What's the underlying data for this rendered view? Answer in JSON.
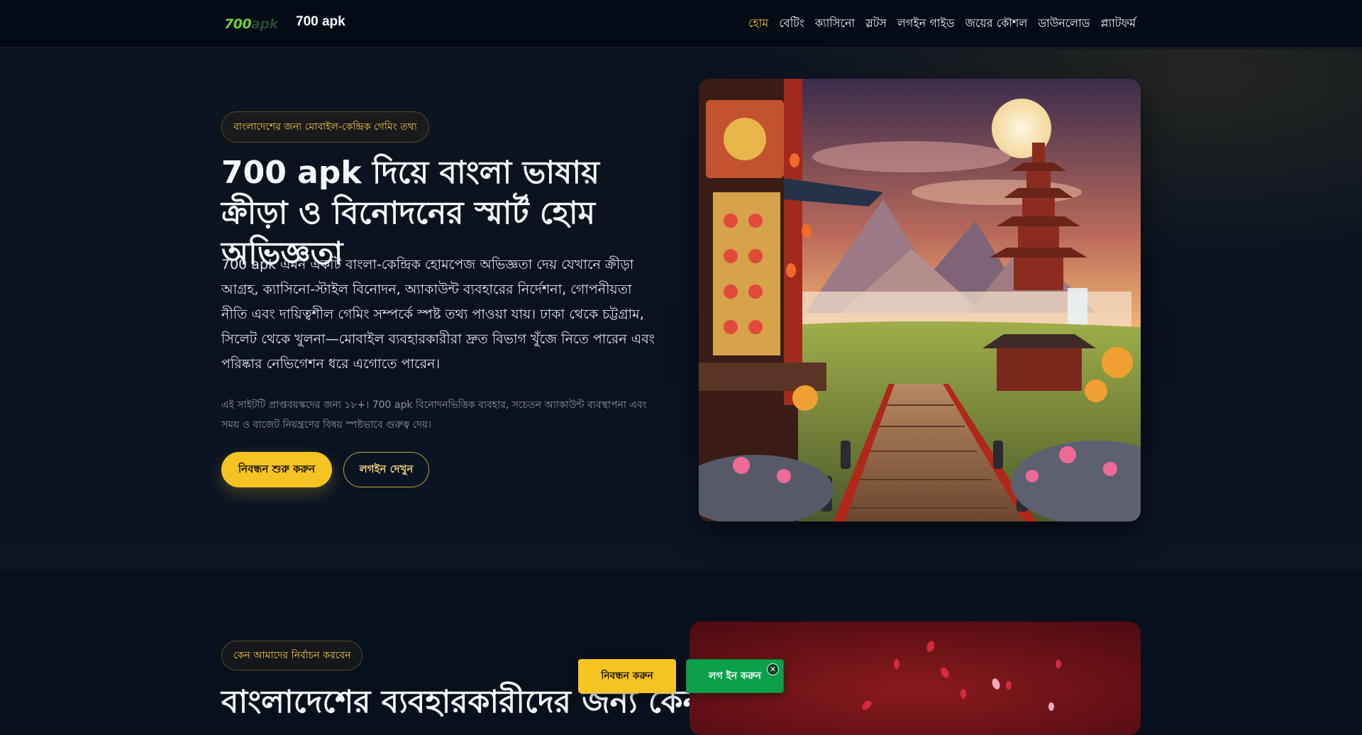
{
  "header": {
    "logo_primary": "700",
    "logo_secondary": "apk",
    "site_name": "700 apk",
    "nav": [
      {
        "label": "হোম",
        "active": true
      },
      {
        "label": "বেটিং"
      },
      {
        "label": "ক্যাসিনো"
      },
      {
        "label": "স্লটস"
      },
      {
        "label": "লগইন গাইড"
      },
      {
        "label": "জয়ের কৌশল"
      },
      {
        "label": "ডাউনলোড"
      },
      {
        "label": "প্ল্যাটফর্ম"
      }
    ]
  },
  "hero": {
    "tag": "বাংলাদেশের জন্য মোবাইল-কেন্দ্রিক গেমিং তথ্য",
    "title": "700 apk দিয়ে বাংলা ভাষায় ক্রীড়া ও বিনোদনের স্মার্ট হোম অভিজ্ঞতা",
    "description": "700 apk এমন একটি বাংলা-কেন্দ্রিক হোমপেজ অভিজ্ঞতা দেয় যেখানে ক্রীড়া আগ্রহ, ক্যাসিনো-স্টাইল বিনোদন, অ্যাকাউন্ট ব্যবহারের নির্দেশনা, গোপনীয়তা নীতি এবং দায়িত্বশীল গেমিং সম্পর্কে স্পষ্ট তথ্য পাওয়া যায়। ঢাকা থেকে চট্টগ্রাম, সিলেট থেকে খুলনা—মোবাইল ব্যবহারকারীরা দ্রুত বিভাগ খুঁজে নিতে পারেন এবং পরিষ্কার নেভিগেশন ধরে এগোতে পারেন।",
    "note": "এই সাইটটি প্রাপ্তবয়স্কদের জন্য ১৮+। 700 apk বিনোদনভিত্তিক ব্যবহার, সচেতন অ্যাকাউন্ট ব্যবস্থাপনা এবং সময় ও বাজেট নিয়ন্ত্রণের বিষয় স্পষ্টভাবে গুরুত্ব দেয়।",
    "primary_button": "নিবন্ধন শুরু করুন",
    "secondary_button": "লগইন দেখুন"
  },
  "section2": {
    "tag": "কেন আমাদের নির্বাচন করবেন",
    "title": "বাংলাদেশের ব্যবহারকারীদের জন্য কেন"
  },
  "floating_bar": {
    "register_label": "নিবন্ধন করুন",
    "login_label": "লগ ইন করুন",
    "close_label": "✕"
  },
  "colors": {
    "accent": "#f6c422",
    "nav_active": "#f5c232",
    "login_green": "#0aa04a",
    "background": "#07101d"
  }
}
